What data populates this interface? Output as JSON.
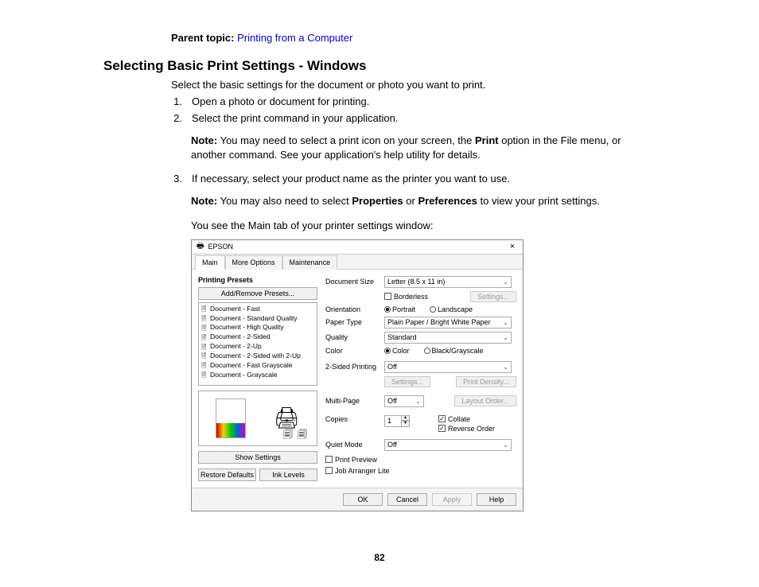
{
  "parent_topic_label": "Parent topic:",
  "parent_topic_link": "Printing from a Computer",
  "section_title": "Selecting Basic Print Settings - Windows",
  "intro": "Select the basic settings for the document or photo you want to print.",
  "steps": {
    "s1": "Open a photo or document for printing.",
    "s2": "Select the print command in your application.",
    "s3": "If necessary, select your product name as the printer you want to use."
  },
  "note1": {
    "note_label": "Note:",
    "part1": " You may need to select a print icon on your screen, the ",
    "b1": "Print",
    "part2": " option in the File menu, or another command. See your application's help utility for details."
  },
  "note2": {
    "note_label": "Note:",
    "part1": " You may also need to select ",
    "b1": "Properties",
    "part2": " or ",
    "b2": "Preferences",
    "part3": " to view your print settings."
  },
  "caption": "You see the Main tab of your printer settings window:",
  "dialog": {
    "app_name": "EPSON",
    "tabs": {
      "main": "Main",
      "more": "More Options",
      "maint": "Maintenance"
    },
    "presets_label": "Printing Presets",
    "add_remove": "Add/Remove Presets...",
    "presets": [
      "Document - Fast",
      "Document - Standard Quality",
      "Document - High Quality",
      "Document - 2-Sided",
      "Document - 2-Up",
      "Document - 2-Sided with 2-Up",
      "Document - Fast Grayscale",
      "Document - Grayscale"
    ],
    "show_settings": "Show Settings",
    "restore_defaults": "Restore Defaults",
    "ink_levels": "Ink Levels",
    "labels": {
      "doc_size": "Document Size",
      "borderless": "Borderless",
      "settings": "Settings...",
      "orientation": "Orientation",
      "portrait": "Portrait",
      "landscape": "Landscape",
      "paper_type": "Paper Type",
      "quality": "Quality",
      "color": "Color",
      "color_opt": "Color",
      "bw_opt": "Black/Grayscale",
      "two_sided": "2-Sided Printing",
      "print_density": "Print Density...",
      "multi_page": "Multi-Page",
      "layout_order": "Layout Order...",
      "copies": "Copies",
      "collate": "Collate",
      "reverse": "Reverse Order",
      "quiet_mode": "Quiet Mode",
      "print_preview": "Print Preview",
      "job_arranger": "Job Arranger Lite"
    },
    "values": {
      "doc_size": "Letter (8.5 x 11 in)",
      "paper_type": "Plain Paper / Bright White Paper",
      "quality": "Standard",
      "two_sided": "Off",
      "multi_page": "Off",
      "copies": "1",
      "quiet_mode": "Off"
    },
    "footer": {
      "ok": "OK",
      "cancel": "Cancel",
      "apply": "Apply",
      "help": "Help"
    }
  },
  "page_number": "82"
}
